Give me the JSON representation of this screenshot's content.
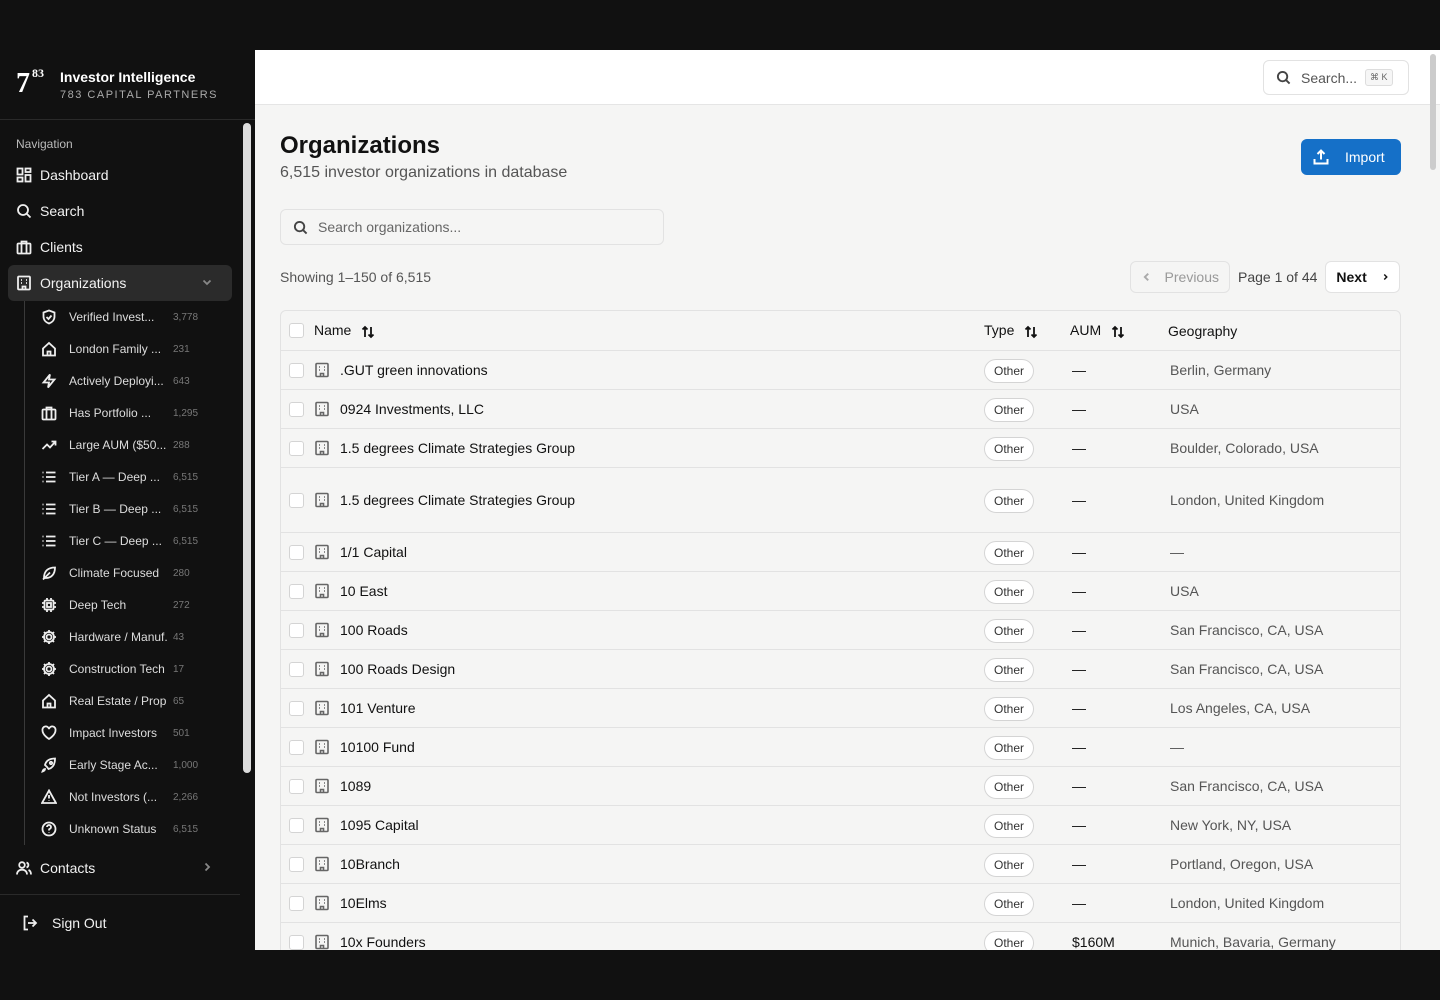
{
  "brand": {
    "logo_main": "7",
    "logo_sup": "83",
    "title": "Investor Intelligence",
    "subtitle": "783 CAPITAL PARTNERS"
  },
  "nav": {
    "label": "Navigation",
    "items": [
      {
        "label": "Dashboard",
        "icon": "dashboard-icon"
      },
      {
        "label": "Search",
        "icon": "search-icon"
      },
      {
        "label": "Clients",
        "icon": "briefcase-icon"
      },
      {
        "label": "Organizations",
        "icon": "building-icon"
      }
    ],
    "sub_items": [
      {
        "label": "Verified Invest...",
        "count": "3,778",
        "icon": "shield-check-icon"
      },
      {
        "label": "London Family ...",
        "count": "231",
        "icon": "home-icon"
      },
      {
        "label": "Actively Deployi...",
        "count": "643",
        "icon": "bolt-icon"
      },
      {
        "label": "Has Portfolio ...",
        "count": "1,295",
        "icon": "briefcase-icon"
      },
      {
        "label": "Large AUM ($50...",
        "count": "288",
        "icon": "trending-up-icon"
      },
      {
        "label": "Tier A — Deep ...",
        "count": "6,515",
        "icon": "list-icon"
      },
      {
        "label": "Tier B — Deep ...",
        "count": "6,515",
        "icon": "list-icon"
      },
      {
        "label": "Tier C — Deep ...",
        "count": "6,515",
        "icon": "list-icon"
      },
      {
        "label": "Climate Focused",
        "count": "280",
        "icon": "leaf-icon"
      },
      {
        "label": "Deep Tech",
        "count": "272",
        "icon": "chip-icon"
      },
      {
        "label": "Hardware / Manuf...",
        "count": "43",
        "icon": "cog-icon"
      },
      {
        "label": "Construction Tech",
        "count": "17",
        "icon": "cog-icon"
      },
      {
        "label": "Real Estate / Prop...",
        "count": "65",
        "icon": "home-icon"
      },
      {
        "label": "Impact Investors",
        "count": "501",
        "icon": "heart-icon"
      },
      {
        "label": "Early Stage Ac...",
        "count": "1,000",
        "icon": "rocket-icon"
      },
      {
        "label": "Not Investors (...",
        "count": "2,266",
        "icon": "warning-icon"
      },
      {
        "label": "Unknown Status",
        "count": "6,515",
        "icon": "question-icon"
      }
    ],
    "contacts": "Contacts",
    "signout": "Sign Out"
  },
  "header": {
    "search_placeholder": "Search...",
    "shortcut": "⌘ K"
  },
  "page": {
    "title": "Organizations",
    "subtitle": "6,515 investor organizations in database",
    "import_label": "Import",
    "search_placeholder": "Search organizations...",
    "showing": "Showing 1–150 of 6,515",
    "prev": "Previous",
    "page_info": "Page 1 of 44",
    "next": "Next"
  },
  "table": {
    "headers": {
      "name": "Name",
      "type": "Type",
      "aum": "AUM",
      "geo": "Geography"
    },
    "rows": [
      {
        "name": ".GUT green innovations",
        "type": "Other",
        "aum": "—",
        "geo": "Berlin, Germany"
      },
      {
        "name": "0924 Investments, LLC",
        "type": "Other",
        "aum": "—",
        "geo": "USA"
      },
      {
        "name": "1.5 degrees Climate Strategies Group",
        "type": "Other",
        "aum": "—",
        "geo": "Boulder, Colorado, USA"
      },
      {
        "name": "1.5 degrees Climate Strategies Group",
        "type": "Other",
        "aum": "—",
        "geo": "London, United Kingdom"
      },
      {
        "name": "1/1 Capital",
        "type": "Other",
        "aum": "—",
        "geo": "—"
      },
      {
        "name": "10 East",
        "type": "Other",
        "aum": "—",
        "geo": "USA"
      },
      {
        "name": "100 Roads",
        "type": "Other",
        "aum": "—",
        "geo": "San Francisco, CA, USA"
      },
      {
        "name": "100 Roads Design",
        "type": "Other",
        "aum": "—",
        "geo": "San Francisco, CA, USA"
      },
      {
        "name": "101 Venture",
        "type": "Other",
        "aum": "—",
        "geo": "Los Angeles, CA, USA"
      },
      {
        "name": "10100 Fund",
        "type": "Other",
        "aum": "—",
        "geo": "—"
      },
      {
        "name": "1089",
        "type": "Other",
        "aum": "—",
        "geo": "San Francisco, CA, USA"
      },
      {
        "name": "1095 Capital",
        "type": "Other",
        "aum": "—",
        "geo": "New York, NY, USA"
      },
      {
        "name": "10Branch",
        "type": "Other",
        "aum": "—",
        "geo": "Portland, Oregon, USA"
      },
      {
        "name": "10Elms",
        "type": "Other",
        "aum": "—",
        "geo": "London, United Kingdom"
      },
      {
        "name": "10x Founders",
        "type": "Other",
        "aum": "$160M",
        "geo": "Munich, Bavaria, Germany"
      }
    ]
  }
}
